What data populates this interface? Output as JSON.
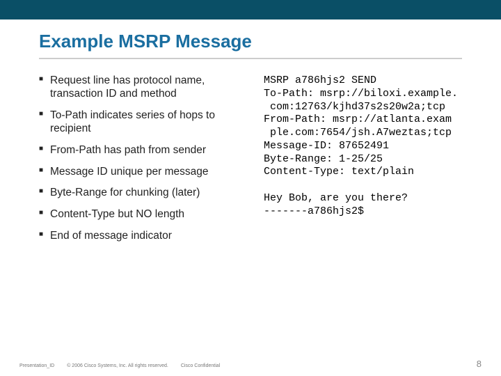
{
  "header": {
    "title": "Example MSRP Message"
  },
  "bullets": {
    "items": [
      {
        "text": "Request line has protocol name, transaction ID and method"
      },
      {
        "text": "To-Path indicates series of hops to recipient"
      },
      {
        "text": "From-Path has path from sender"
      },
      {
        "text": "Message ID unique per message"
      },
      {
        "text": "Byte-Range for chunking (later)"
      },
      {
        "text": "Content-Type but NO length"
      },
      {
        "text": "End of message indicator"
      }
    ]
  },
  "code": {
    "text": "MSRP a786hjs2 SEND\nTo-Path: msrp://biloxi.example.\n com:12763/kjhd37s2s20w2a;tcp\nFrom-Path: msrp://atlanta.exam\n ple.com:7654/jsh.A7weztas;tcp\nMessage-ID: 87652491\nByte-Range: 1-25/25\nContent-Type: text/plain\n\nHey Bob, are you there?\n-------a786hjs2$"
  },
  "footer": {
    "id_label": "Presentation_ID",
    "copyright": "© 2006 Cisco Systems, Inc. All rights reserved.",
    "confidential": "Cisco Confidential",
    "page_number": "8"
  }
}
